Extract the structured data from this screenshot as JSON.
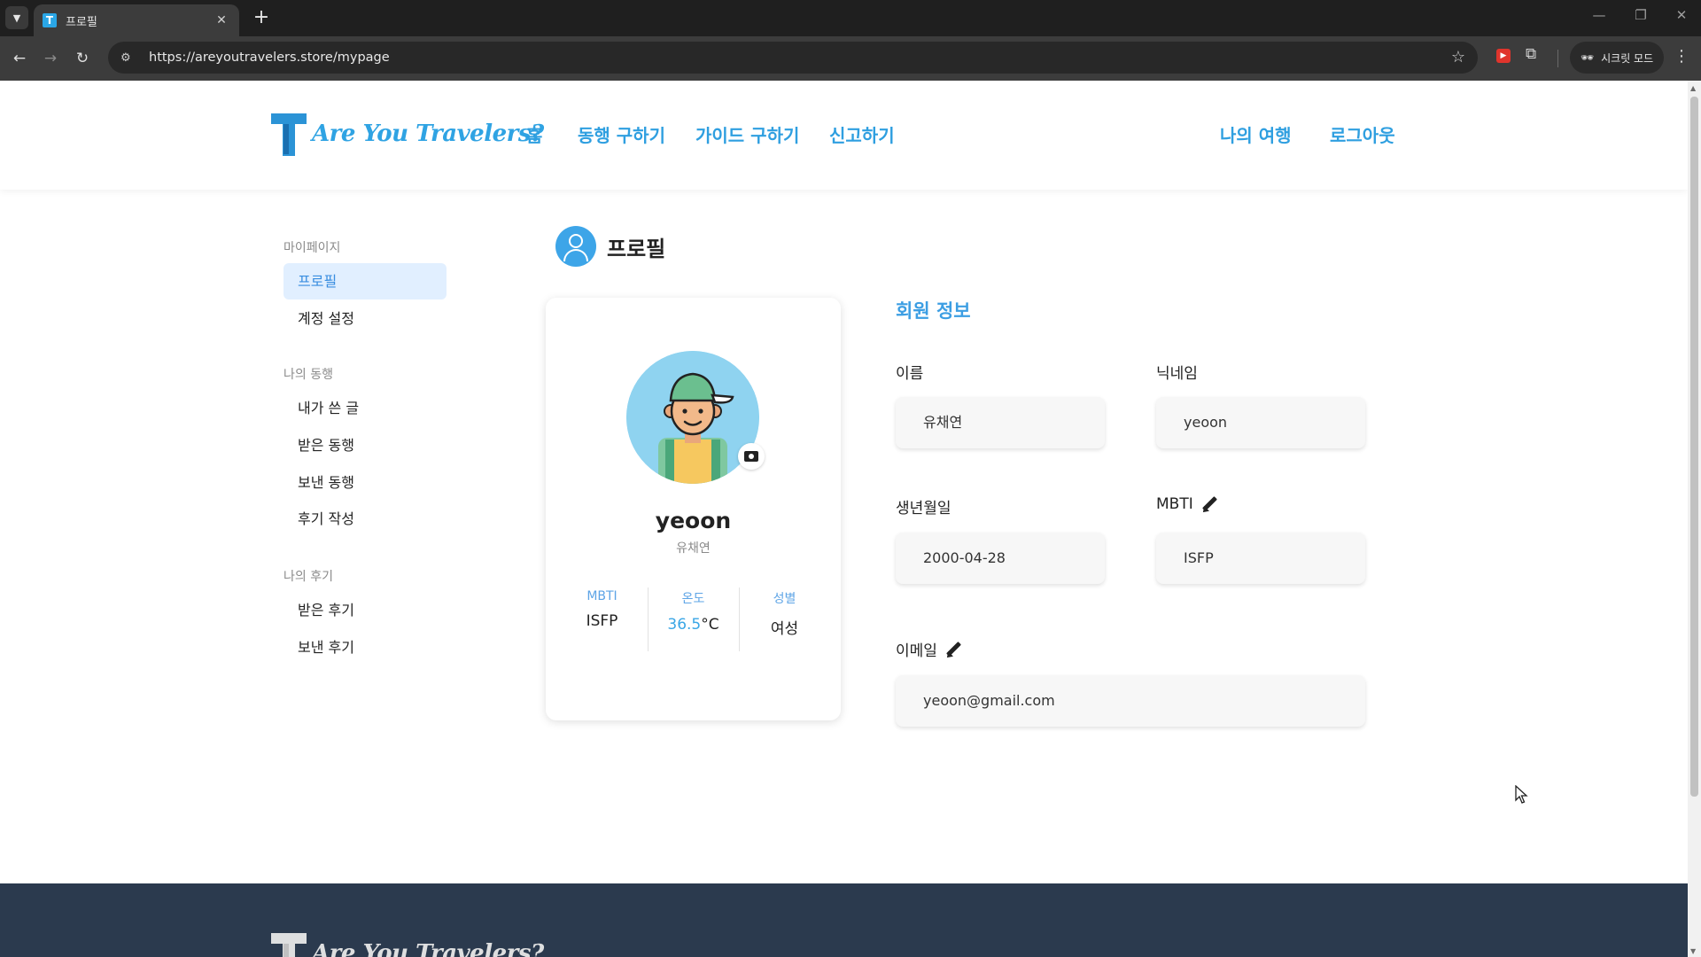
{
  "browser": {
    "tab_title": "프로필",
    "tab_favicon": "T",
    "url": "https://areyoutravelers.store/mypage",
    "incognito_label": "시크릿 모드",
    "new_tab": "+",
    "close_tab": "✕"
  },
  "site": {
    "logo_text": "Are You Travelers?",
    "nav": [
      "홈",
      "동행 구하기",
      "가이드 구하기",
      "신고하기"
    ],
    "nav_right": [
      "나의 여행",
      "로그아웃"
    ]
  },
  "sidebar": {
    "groups": [
      {
        "title": "마이페이지",
        "items": [
          "프로필",
          "계정 설정"
        ]
      },
      {
        "title": "나의 동행",
        "items": [
          "내가 쓴 글",
          "받은 동행",
          "보낸 동행",
          "후기 작성"
        ]
      },
      {
        "title": "나의 후기",
        "items": [
          "받은 후기",
          "보낸 후기"
        ]
      }
    ],
    "active": "프로필"
  },
  "profile": {
    "title": "프로필",
    "nickname": "yeoon",
    "name": "유채연",
    "stats": {
      "mbti_label": "MBTI",
      "mbti": "ISFP",
      "temp_label": "온도",
      "temp_value": "36.5",
      "temp_unit": "°C",
      "gender_label": "성별",
      "gender": "여성"
    }
  },
  "member_info": {
    "title": "회원 정보",
    "name_label": "이름",
    "name": "유채연",
    "nickname_label": "닉네임",
    "nickname": "yeoon",
    "birth_label": "생년월일",
    "birth": "2000-04-28",
    "mbti_label": "MBTI",
    "mbti": "ISFP",
    "email_label": "이메일",
    "email": "yeoon@gmail.com"
  },
  "colors": {
    "brand": "#2f9fe0",
    "active_bg": "#e1efff",
    "footer": "#2b3a4e"
  }
}
